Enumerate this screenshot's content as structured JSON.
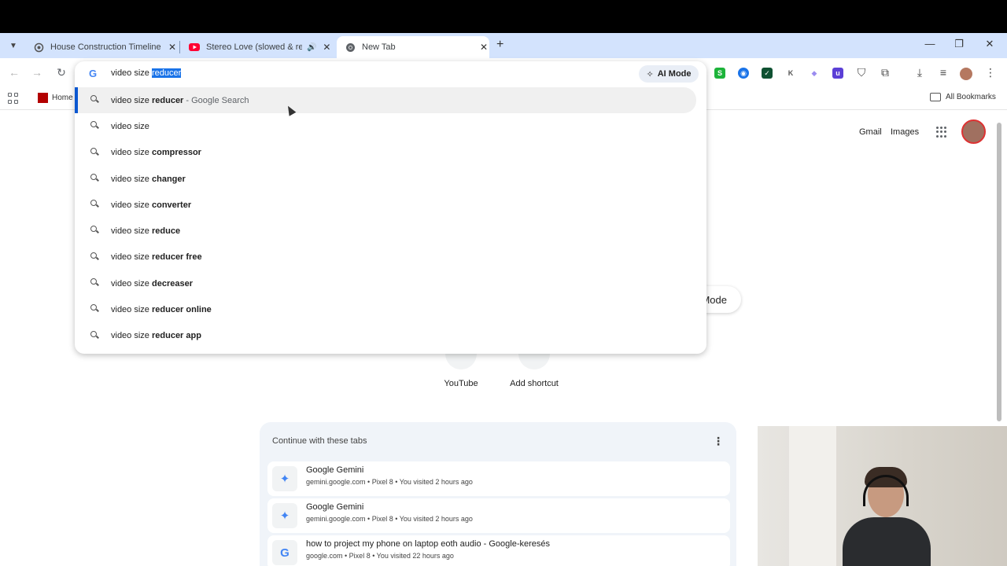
{
  "tabs": [
    {
      "label": "House Construction Timeline",
      "active": false
    },
    {
      "label": "Stereo Love (slowed & reve",
      "active": false
    },
    {
      "label": "New Tab",
      "active": true
    }
  ],
  "tab_close_glyph": "✕",
  "new_tab_glyph": "+",
  "window_controls": {
    "minimize": "—",
    "maximize": "❐",
    "close": "✕"
  },
  "nav": {
    "back": "←",
    "forward": "→",
    "reload": "↻"
  },
  "omnibox": {
    "typed": "video size ",
    "selected_completion": "reducer",
    "ai_mode_label": "AI Mode",
    "suggestions": [
      {
        "prefix": "video size ",
        "bold": "reducer",
        "suffix": " - Google Search",
        "highlighted": true
      },
      {
        "prefix": "video size",
        "bold": "",
        "suffix": "",
        "highlighted": false
      },
      {
        "prefix": "video size ",
        "bold": "compressor",
        "suffix": "",
        "highlighted": false
      },
      {
        "prefix": "video size ",
        "bold": "changer",
        "suffix": "",
        "highlighted": false
      },
      {
        "prefix": "video size ",
        "bold": "converter",
        "suffix": "",
        "highlighted": false
      },
      {
        "prefix": "video size ",
        "bold": "reduce",
        "suffix": "",
        "highlighted": false
      },
      {
        "prefix": "video size ",
        "bold": "reducer free",
        "suffix": "",
        "highlighted": false
      },
      {
        "prefix": "video size ",
        "bold": "decreaser",
        "suffix": "",
        "highlighted": false
      },
      {
        "prefix": "video size ",
        "bold": "reducer online",
        "suffix": "",
        "highlighted": false
      },
      {
        "prefix": "video size ",
        "bold": "reducer app",
        "suffix": "",
        "highlighted": false
      }
    ]
  },
  "extensions": [
    {
      "letter": "S",
      "color": "#1db33a"
    },
    {
      "letter": "◉",
      "color": "#1a73e8"
    },
    {
      "letter": "✓",
      "color": "#0f5132"
    },
    {
      "letter": "K",
      "color": "#555555"
    },
    {
      "letter": "◆",
      "color": "#9b8cf0"
    },
    {
      "letter": "u",
      "color": "#5b3fd6"
    }
  ],
  "bookmarks": {
    "home_label": "Home",
    "all_bookmarks_label": "All Bookmarks"
  },
  "ntp": {
    "gmail": "Gmail",
    "images": "Images",
    "mode_partial": "Mode",
    "shortcuts": [
      {
        "label": "YouTube"
      },
      {
        "label": "Add shortcut"
      }
    ],
    "continue": {
      "title": "Continue with these tabs",
      "items": [
        {
          "title": "Google Gemini",
          "meta": "gemini.google.com • Pixel 8 • You visited 2 hours ago",
          "icon": "✦"
        },
        {
          "title": "Google Gemini",
          "meta": "gemini.google.com • Pixel 8 • You visited 2 hours ago",
          "icon": "✦"
        },
        {
          "title": "how to project my phone on laptop eoth audio - Google-keresés",
          "meta": "google.com • Pixel 8 • You visited 22 hours ago",
          "icon": "G"
        }
      ]
    }
  },
  "colors": {
    "tabstrip": "#d3e3fd",
    "accent": "#1a73e8",
    "gemini": "#4285f4",
    "youtube": "#ff0033"
  }
}
